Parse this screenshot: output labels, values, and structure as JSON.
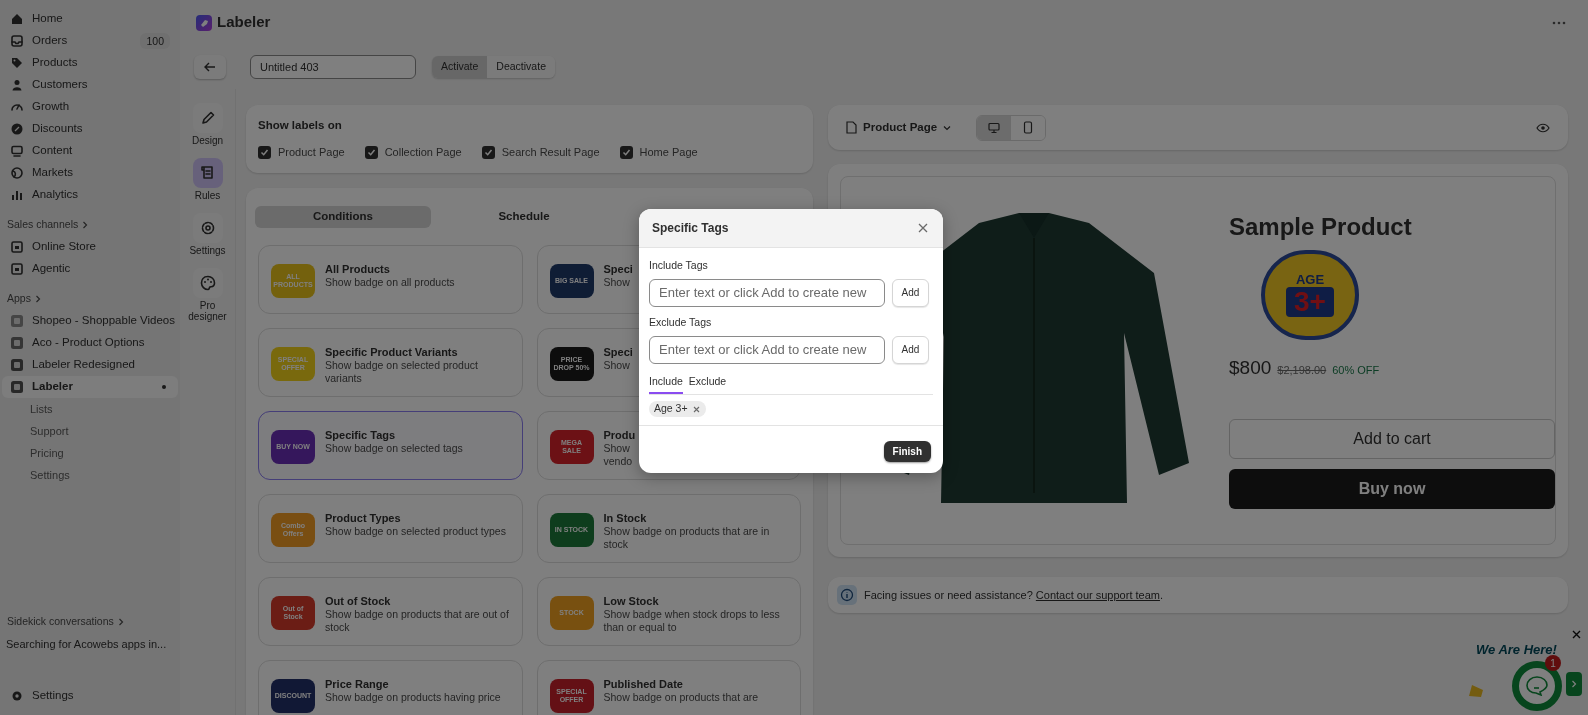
{
  "sidebar": {
    "nav": [
      {
        "label": "Home",
        "selected": false
      },
      {
        "label": "Orders",
        "count": "100",
        "selected": false
      },
      {
        "label": "Products",
        "selected": false
      },
      {
        "label": "Customers",
        "selected": false
      },
      {
        "label": "Growth",
        "selected": false
      },
      {
        "label": "Discounts",
        "selected": false
      },
      {
        "label": "Content",
        "selected": false
      },
      {
        "label": "Markets",
        "selected": false
      },
      {
        "label": "Analytics",
        "selected": false
      }
    ],
    "sales_channels": {
      "heading": "Sales channels",
      "items": [
        {
          "label": "Online Store",
          "selected": false
        },
        {
          "label": "Agentic",
          "selected": false
        }
      ]
    },
    "apps": {
      "heading": "Apps",
      "items": [
        {
          "label": "Shopeo - Shoppable Videos",
          "selected": false
        },
        {
          "label": "Aco - Product Options",
          "selected": false
        },
        {
          "label": "Labeler Redesigned",
          "selected": false
        },
        {
          "label": "Labeler",
          "selected": true,
          "children": [
            {
              "label": "Lists"
            },
            {
              "label": "Support"
            },
            {
              "label": "Pricing"
            },
            {
              "label": "Settings"
            }
          ]
        }
      ]
    },
    "sidekick": {
      "heading": "Sidekick conversations",
      "item": "Searching for Acowebs apps in..."
    },
    "footer": "Settings"
  },
  "header": {
    "title": "Labeler"
  },
  "toolbar": {
    "name_value": "Untitled 403",
    "status_buttons": [
      {
        "label": "Activate",
        "selected": true
      },
      {
        "label": "Deactivate",
        "selected": false
      }
    ]
  },
  "rail": [
    {
      "label": "Design",
      "selected": false
    },
    {
      "label": "Rules",
      "selected": true
    },
    {
      "label": "Settings",
      "selected": false
    },
    {
      "label": "Pro designer",
      "selected": false
    }
  ],
  "show_labels": {
    "title": "Show labels on",
    "options": [
      {
        "label": "Product Page",
        "checked": true
      },
      {
        "label": "Collection Page",
        "checked": true
      },
      {
        "label": "Search Result Page",
        "checked": true
      },
      {
        "label": "Home Page",
        "checked": true
      }
    ]
  },
  "condition_tabs": [
    {
      "label": "Conditions",
      "selected": true
    },
    {
      "label": "Schedule",
      "selected": false
    }
  ],
  "conditions": [
    {
      "kind": "full",
      "title": "All Products",
      "description": "Show badge on all products",
      "selected": false,
      "badge": {
        "text": "ALL PRODUCTS"
      }
    },
    {
      "kind": "clipped",
      "title": "Speci",
      "lines": [
        "Show"
      ],
      "selected": false,
      "badge": {
        "text": "BIG SALE"
      }
    },
    {
      "kind": "full",
      "title": "Specific Product Variants",
      "description": "Show badge on selected product variants",
      "selected": false,
      "badge": {
        "text": "SPECIAL OFFER"
      }
    },
    {
      "kind": "clipped",
      "title": "Speci",
      "lines": [
        "Show"
      ],
      "selected": false,
      "badge": {
        "text": "PRICE DROP 50%"
      }
    },
    {
      "kind": "full",
      "title": "Specific Tags",
      "description": "Show badge on selected tags",
      "selected": true,
      "badge": {
        "text": "BUY NOW"
      }
    },
    {
      "kind": "clipped",
      "title": "Produ",
      "lines": [
        "Show",
        "vendo"
      ],
      "selected": false,
      "badge": {
        "text": "MEGA SALE"
      }
    },
    {
      "kind": "full",
      "title": "Product Types",
      "description": "Show badge on selected product types",
      "selected": false,
      "badge": {
        "text": "Combo Offers"
      }
    },
    {
      "kind": "full",
      "title": "In Stock",
      "description": "Show badge on products that are in stock",
      "selected": false,
      "badge": {
        "text": "IN STOCK"
      }
    },
    {
      "kind": "full",
      "title": "Out of Stock",
      "description": "Show badge on products that are out of stock",
      "selected": false,
      "badge": {
        "text": "Out of Stock"
      }
    },
    {
      "kind": "full",
      "title": "Low Stock",
      "description": "Show badge when stock drops to less than or equal to",
      "selected": false,
      "badge": {
        "text": "STOCK"
      }
    },
    {
      "kind": "full",
      "title": "Price Range",
      "description": "Show badge on products having price",
      "selected": false,
      "badge": {
        "text": "DISCOUNT"
      }
    },
    {
      "kind": "full",
      "title": "Published Date",
      "description": "Show badge on products that are",
      "selected": false,
      "badge": {
        "text": "SPECIAL OFFER"
      }
    }
  ],
  "preview": {
    "page_select": "Product Page",
    "views": [
      {
        "kind": "desktop",
        "selected": true
      },
      {
        "kind": "mobile",
        "selected": false
      }
    ],
    "product": {
      "title": "Sample Product",
      "badge_top": "AGE",
      "badge_main": "3+",
      "price": "$800",
      "compare_price": "$2,198.00",
      "discount": "60% OFF",
      "add_to_cart": "Add to cart",
      "buy_now": "Buy now"
    }
  },
  "help": {
    "text": "Facing issues or need assistance?",
    "link": "Contact our support team",
    "end": "."
  },
  "modal": {
    "title": "Specific Tags",
    "include_label": "Include Tags",
    "include_placeholder": "Enter text or click Add to create new",
    "exclude_label": "Exclude Tags",
    "exclude_placeholder": "Enter text or click Add to create new",
    "include_add": "Add",
    "exclude_add": "Add",
    "tabs": [
      {
        "label": "Include",
        "selected": true
      },
      {
        "label": "Exclude",
        "selected": false
      }
    ],
    "chips": [
      "Age 3+"
    ],
    "finish": "Finish"
  },
  "chat": {
    "label": "We Are Here!",
    "badge": "1"
  }
}
